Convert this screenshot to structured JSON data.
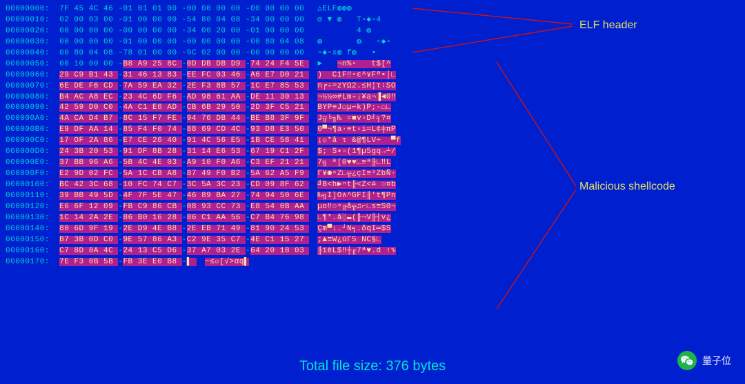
{
  "labels": {
    "elf_header": "ELF header",
    "malicious_shellcode": "Malicious shellcode"
  },
  "footer": "Total file size: 376 bytes",
  "watermark": "量子位",
  "rows": [
    {
      "offset": "00000000:",
      "hex": "7F 45 4C 46-01 01 01 00-00 00 00 00-00 00 00 00",
      "ascii": "△ELF◍◍◍",
      "hl_start": -1
    },
    {
      "offset": "00000010:",
      "hex": "02 00 03 00-01 00 00 00-54 80 04 08-34 00 00 00",
      "ascii": "◎ ▼ ◍   T▫◆▫4",
      "hl_start": -1
    },
    {
      "offset": "00000020:",
      "hex": "00 00 00 00-00 00 00 00-34 00 20 00-01 00 00 00",
      "ascii": "        4 ◍",
      "hl_start": -1
    },
    {
      "offset": "00000030:",
      "hex": "00 00 00 00-01 00 00 00-00 00 00 00-00 80 04 08",
      "ascii": "◍       ◍   ▫◆▫",
      "hl_start": -1
    },
    {
      "offset": "00000040:",
      "hex": "00 80 04 08-78 01 00 00-9C 02 00 00-00 00 00 00",
      "ascii": "▫◆▫x◍ f◍   •",
      "hl_start": -1
    },
    {
      "offset": "00000050:",
      "hex": "00 10 00 00-B8 A9 25 8C-0D DB DB D9-74 24 F4 5E",
      "ascii": "►   ",
      "hl_start": 4,
      "ascii_hl": "¬n%▫   t$[^"
    },
    {
      "offset": "00000060:",
      "hex": "29 C9 B1 43-31 46 13 83-EE FC 03 46-A6 E7 D0 21",
      "ascii": "",
      "hl_start": 0,
      "ascii_hl": ")  C1F‼▫ε^∨Fª▪│∟"
    },
    {
      "offset": "00000070:",
      "hex": "6E DE F6 CD-7A 59 EA 32-2E F3 8B 57-1C E7 85 53",
      "ascii": "",
      "hl_start": 0,
      "ascii_hl": "n╒÷=zYΩ2.≤H¦τ∶SO"
    },
    {
      "offset": "00000080:",
      "hex": "B4 AC A8 EC-23 4C 6D F6-AD 98 61 AA-DE 11 30 13",
      "ascii": "",
      "hl_start": 0,
      "ascii_hl": "¬½½∞#Lm÷¡¥a¬▐◄0‼"
    },
    {
      "offset": "00000090:",
      "hex": "42 59 D0 C0-4A C1 E6 AD-CB 6B 29 50-2D 3F C5 21",
      "ascii": "",
      "hl_start": 0,
      "ascii_hl": "BYP≡J⌂μ⌐k)P;-⌂∟"
    },
    {
      "offset": "000000A0:",
      "hex": "4A CA D4 B7-8C 15 F7 FE-94 76 DB 44-BE B8 3F 9F",
      "ascii": "",
      "hl_start": 0,
      "ascii_hl": "J╦╘╖₧ ≈■v▫D╛╕?¤"
    },
    {
      "offset": "000000B0:",
      "hex": "E9 DF AA 14-85 F4 F0 74-88 69 CD 4C-93 D8 E3 50",
      "ascii": "",
      "hl_start": 0,
      "ascii_hl": "Θ▀¬¶à·≡t▫i═L¢╪πP"
    },
    {
      "offset": "000000C0:",
      "hex": "17 OF 2A 86-E7 CE 26 40-91 4C 56 E5-1B CE 58 41",
      "ascii": "",
      "hl_start": 0,
      "ascii_hl": "↨☼*å τ &@¶LV÷  ▀f"
    },
    {
      "offset": "000000D0:",
      "hex": "24 3B 20 53-91 DF 8B 28-31 14 E6 53-67 19 C1 2F",
      "ascii": "",
      "hl_start": 0,
      "ascii_hl": "$; S▪▫(1¶µ5gq→┴/"
    },
    {
      "offset": "000000E0:",
      "hex": "37 BB 96 A6-5B 4C 4E 03-A9 10 F0 A6-C3 EF 21 21",
      "ascii": "",
      "hl_start": 0,
      "ascii_hl": "7╗ ª[0♥♥∟≡ª╟∟‼L"
    },
    {
      "offset": "000000F0:",
      "hex": "E2 9D 02 FC-5A 1C CB A8-87 49 F0 B2-5A 62 A5 F9",
      "ascii": "",
      "hl_start": 0,
      "ascii_hl": "Γ¥☻ⁿZ∟╦¿çI≡²ZbÑ·"
    },
    {
      "offset": "00000100:",
      "hex": "BC 42 3C 68-10 FC 74 C7-3C 5A 3C 23-CD 09 8F 62",
      "ascii": "",
      "hl_start": 0,
      "ascii_hl": "╝B<h►ⁿt╟<Z<# ○¤b"
    },
    {
      "offset": "00000110:",
      "hex": "39 BB 49 5D-4F 7F 5E 47-46 89 BA 27-74 94 50 6E",
      "ascii": "",
      "hl_start": 0,
      "ascii_hl": "₧╗I]O∧^GFI║'t¶Pn"
    },
    {
      "offset": "00000120:",
      "hex": "E6 6F 12 09-FB C9 86 CB-08 93 CC 73-E8 54 0B AA",
      "ascii": "",
      "hl_start": 0,
      "ascii_hl": "µo‼○ⁿ╔å╦♫⌐∟s≡S0¬"
    },
    {
      "offset": "00000130:",
      "hex": "1C 14 2A 2E-86 B0 16 28-86 C1 AA 56-C7 B4 76 98",
      "ascii": "",
      "hl_start": 0,
      "ascii_hl": "∟¶*.å░▬(╟¬V╟┤v¿"
    },
    {
      "offset": "00000140:",
      "hex": "80 6D 9F 19-2E D9 4E B8-2E EB 71 49-81 90 24 53",
      "ascii": "",
      "hl_start": 0,
      "ascii_hl": "Çm▀↓.┘N╕.δqI═$S"
    },
    {
      "offset": "00000150:",
      "hex": "B7 3B 0D C0-9E 57 86 A3-C2 9E 35 C7-4E C1 15 27",
      "ascii": "",
      "hl_start": 0,
      "ascii_hl": ";▲≡W¿úΓ5 NC§∟"
    },
    {
      "offset": "00000160:",
      "hex": "C7 8D 8A 4C-24 13 C5 D6-37 A7 03 2E-64 20 18 03",
      "ascii": "",
      "hl_start": 0,
      "ascii_hl": "╟ïèL$‼┼╓7ª♥.d ↑♑"
    },
    {
      "offset": "00000170:",
      "hex": "7E F3 0B 5B-FB 3E E0 B8-▌",
      "ascii": "",
      "hl_start": 0,
      "ascii_hl": "~≤☼[√>αq▌"
    }
  ]
}
